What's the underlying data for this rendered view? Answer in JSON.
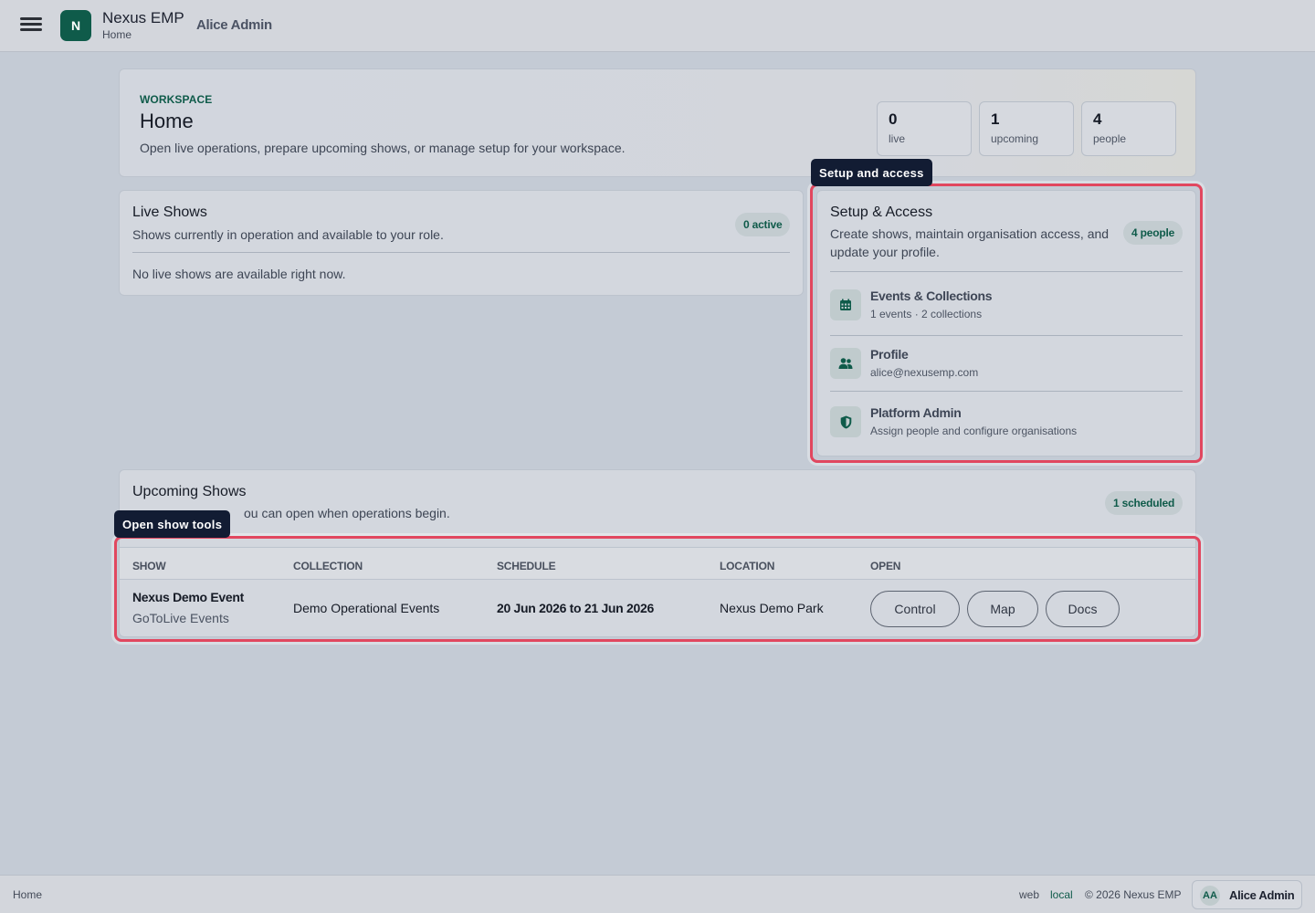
{
  "topbar": {
    "logo_letter": "N",
    "app_name": "Nexus EMP",
    "page": "Home",
    "user": "Alice Admin"
  },
  "hero": {
    "eyebrow": "WORKSPACE",
    "title": "Home",
    "description": "Open live operations, prepare upcoming shows, or manage setup for your workspace.",
    "stats": [
      {
        "value": "0",
        "label": "live"
      },
      {
        "value": "1",
        "label": "upcoming"
      },
      {
        "value": "4",
        "label": "people"
      }
    ]
  },
  "live": {
    "title": "Live Shows",
    "description": "Shows currently in operation and available to your role.",
    "badge": "0 active",
    "empty": "No live shows are available right now."
  },
  "setup": {
    "tooltip": "Setup and access",
    "title": "Setup & Access",
    "description_line1": "Create shows, maintain organisation access, and",
    "description_line2": "update your profile.",
    "badge": "4 people",
    "items": [
      {
        "icon": "calendar-icon",
        "title": "Events & Collections",
        "subtitle": "1 events · 2 collections"
      },
      {
        "icon": "people-icon",
        "title": "Profile",
        "subtitle": "alice@nexusemp.com"
      },
      {
        "icon": "shield-icon",
        "title": "Platform Admin",
        "subtitle": "Assign people and configure organisations"
      }
    ]
  },
  "upcoming": {
    "tooltip": "Open show tools",
    "title": "Upcoming Shows",
    "description_visible": "ou can open when operations begin.",
    "badge": "1 scheduled",
    "columns": [
      "SHOW",
      "COLLECTION",
      "SCHEDULE",
      "LOCATION",
      "OPEN"
    ],
    "rows": [
      {
        "show": "Nexus Demo Event",
        "show_sub": "GoToLive Events",
        "collection": "Demo Operational Events",
        "schedule": "20 Jun 2026 to 21 Jun 2026",
        "location": "Nexus Demo Park",
        "actions": [
          "Control",
          "Map",
          "Docs"
        ]
      }
    ]
  },
  "footer": {
    "home": "Home",
    "web": "web",
    "local": "local",
    "copyright": "© 2026 Nexus EMP",
    "initials": "AA",
    "user": "Alice Admin"
  },
  "colors": {
    "accent": "#0f5b4a",
    "highlight": "#e1475f",
    "tooltip": "#121c33",
    "background": "#c4cbd5"
  }
}
